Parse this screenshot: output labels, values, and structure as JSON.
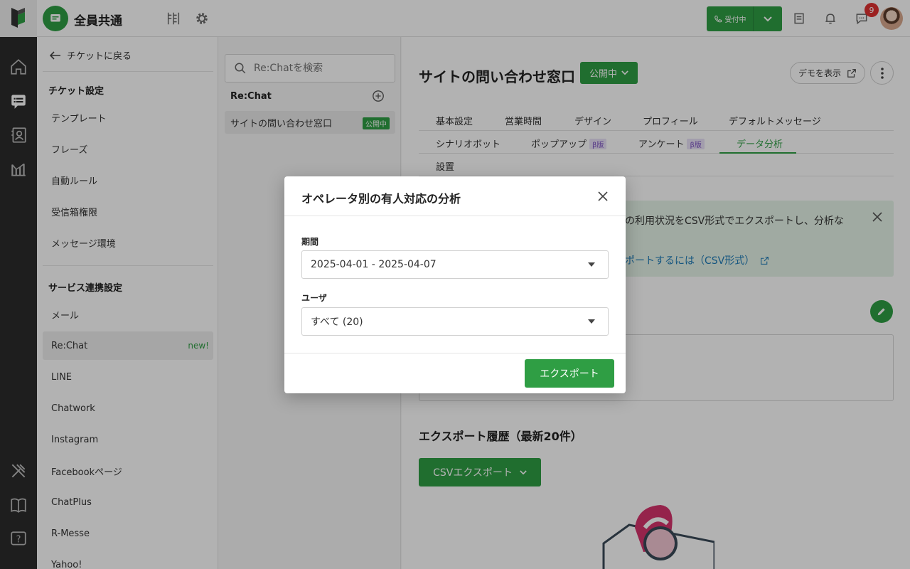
{
  "header": {
    "workspace_title": "全員共通",
    "call_status": "受付中",
    "notification_count": "9"
  },
  "sidebar": {
    "back_label": "チケットに戻る",
    "ticket_section": "チケット設定",
    "ticket_items": [
      {
        "label": "テンプレート"
      },
      {
        "label": "フレーズ"
      },
      {
        "label": "自動ルール"
      },
      {
        "label": "受信箱権限"
      },
      {
        "label": "メッセージ環境"
      }
    ],
    "service_section": "サービス連携設定",
    "service_items": [
      {
        "label": "メール"
      },
      {
        "label": "Re:Chat",
        "badge": "new!"
      },
      {
        "label": "LINE"
      },
      {
        "label": "Chatwork"
      },
      {
        "label": "Instagram"
      },
      {
        "label": "Facebookページ"
      },
      {
        "label": "ChatPlus"
      },
      {
        "label": "R-Messe"
      },
      {
        "label": "Yahoo!"
      }
    ]
  },
  "channel_list": {
    "search_placeholder": "Re:Chatを検索",
    "heading": "Re:Chat",
    "items": [
      {
        "label": "サイトの問い合わせ窓口",
        "badge": "公開中"
      }
    ]
  },
  "main": {
    "title": "サイトの問い合わせ窓口",
    "status_label": "公開中",
    "demo_label": "デモを表示",
    "tabs_row1": [
      "基本設定",
      "営業時間",
      "デザイン",
      "プロフィール",
      "デフォルトメッセージ"
    ],
    "tabs_row2": [
      "シナリオボット",
      "ポップアップ",
      "アンケート",
      "データ分析"
    ],
    "tabs_row3": [
      "設置"
    ],
    "beta_label": "β版",
    "info_text": "の利用状況をCSV形式でエクスポートし、分析な",
    "info_link": "ポートするには（CSV形式）",
    "history_title": "エクスポート履歴（最新20件）",
    "csv_export_label": "CSVエクスポート"
  },
  "modal": {
    "title": "オペレータ別の有人対応の分析",
    "period_label": "期間",
    "period_value": "2025-04-01 - 2025-04-07",
    "user_label": "ユーザ",
    "user_value": "すべて (20)",
    "export_label": "エクスポート"
  },
  "colors": {
    "accent": "#2f9e44",
    "rail": "#2b2b2b",
    "badge_red": "#e03131",
    "link": "#1f7bb8"
  }
}
